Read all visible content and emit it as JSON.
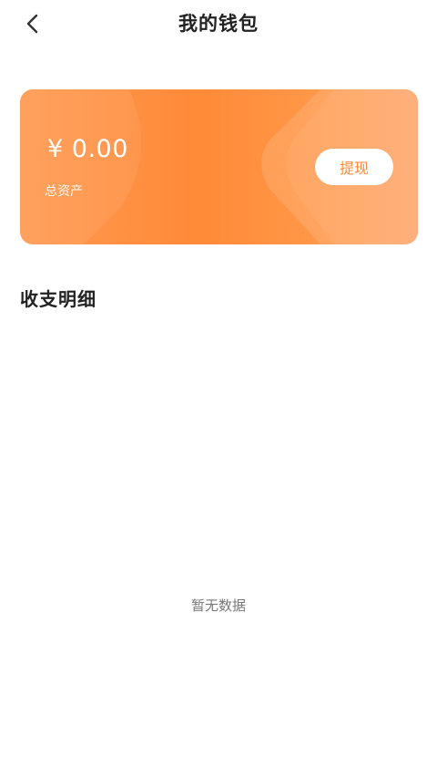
{
  "header": {
    "title": "我的钱包"
  },
  "wallet": {
    "balance": "¥ 0.00",
    "balance_label": "总资产",
    "withdraw_label": "提现"
  },
  "transactions": {
    "section_title": "收支明细",
    "empty_text": "暂无数据"
  },
  "colors": {
    "accent": "#ff8a38",
    "card_light": "#ffa062",
    "title_text": "#222222",
    "muted_text": "#777777"
  },
  "icons": {
    "back": "chevron-left-icon"
  }
}
